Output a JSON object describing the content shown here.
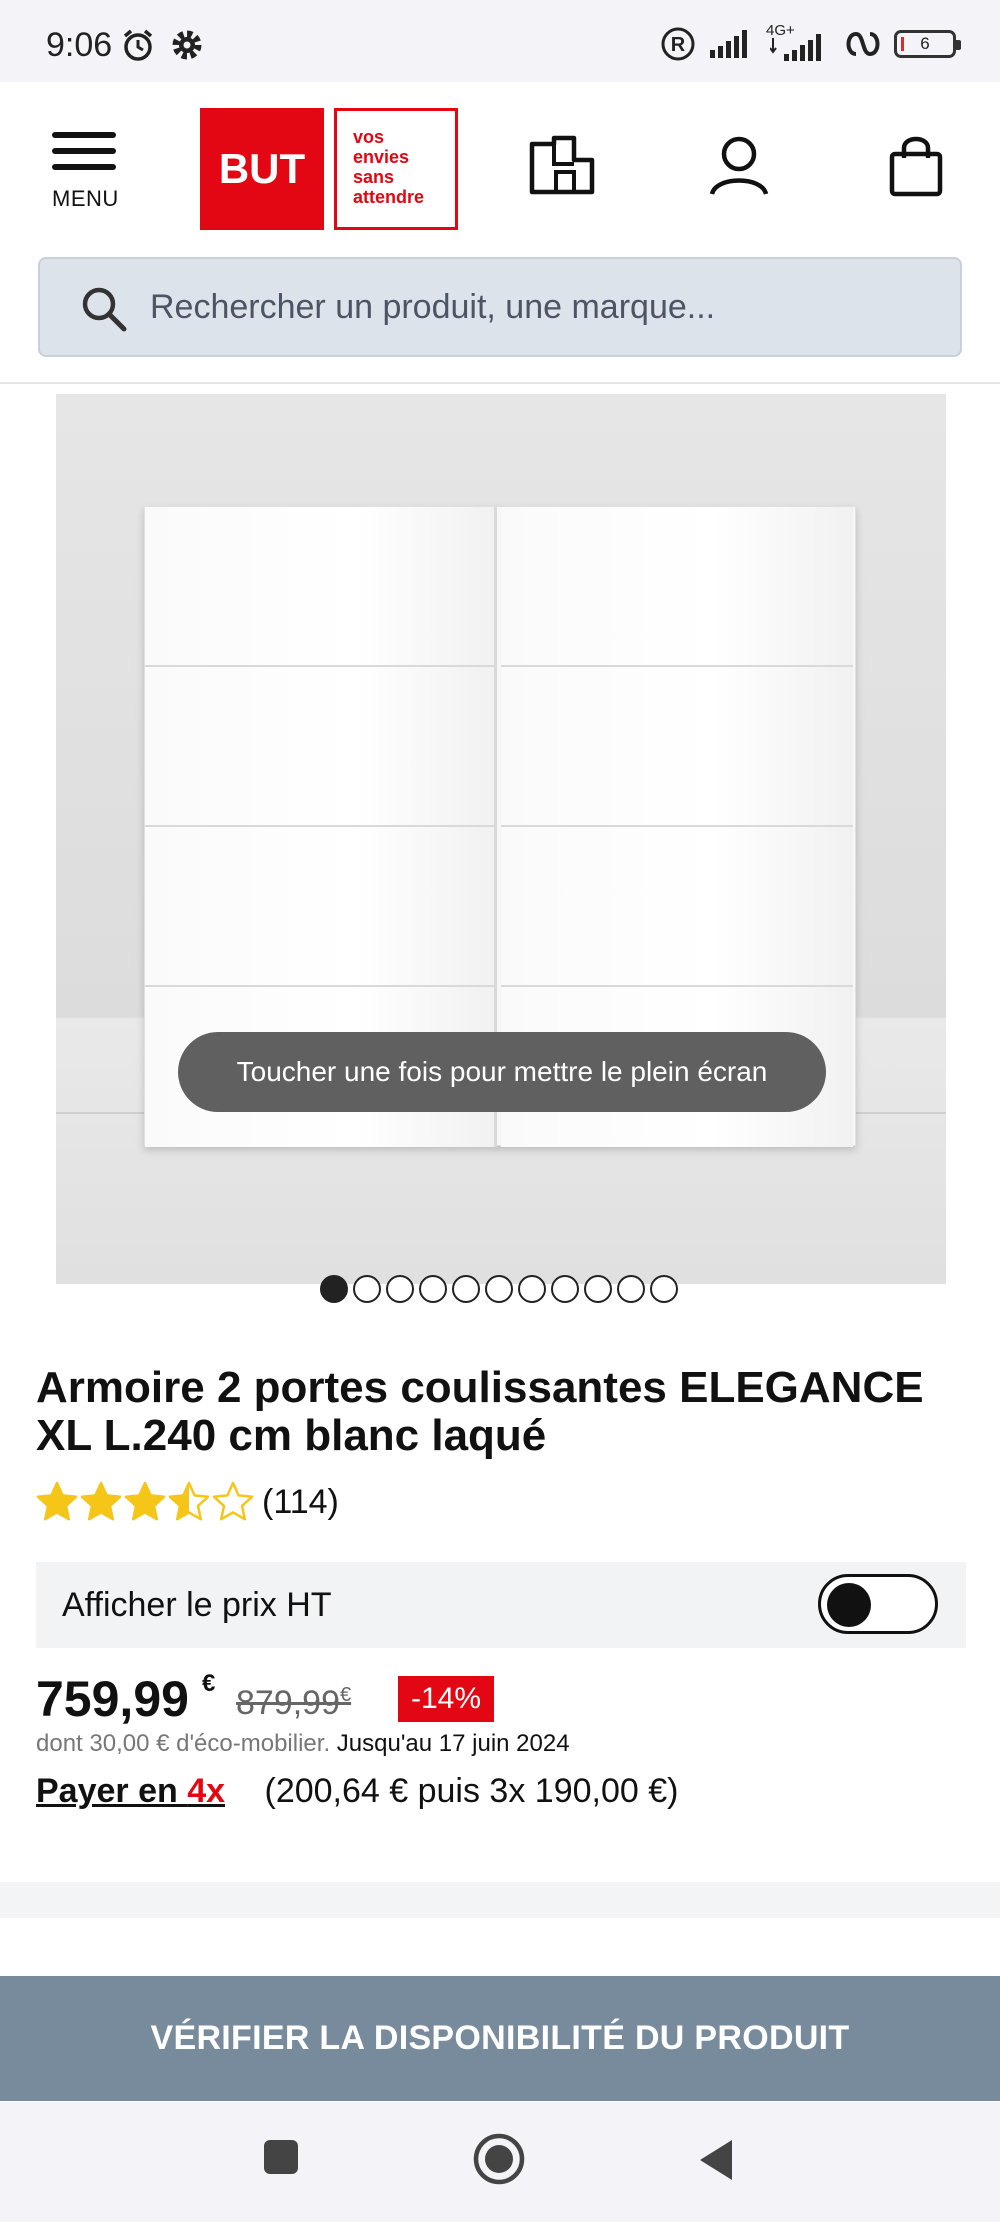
{
  "status_bar": {
    "time": "9:06",
    "network": "4G+",
    "battery": "6"
  },
  "header": {
    "menu_label": "MENU",
    "logo": {
      "brand": "BUT",
      "tagline": [
        "vos",
        "envies",
        "sans",
        "attendre"
      ],
      "color": "#e30613"
    }
  },
  "search": {
    "placeholder": "Rechercher un produit, une marque..."
  },
  "gallery": {
    "toast": "Toucher une fois pour mettre le plein écran",
    "image_count": 11,
    "active_index": 0
  },
  "product": {
    "title": "Armoire 2 portes coulissantes ELEGANCE XL L.240 cm blanc laqué",
    "rating": 3.5,
    "rating_max": 5,
    "review_count": "(114)",
    "ht_label": "Afficher le prix HT",
    "ht_toggle_on": false,
    "price": "759,99",
    "price_currency": "€",
    "old_price": "879,99",
    "old_currency": "€",
    "discount": "-14%",
    "eco_text": "dont 30,00 € d'éco-mobilier.",
    "eco_date": "Jusqu'au 17 juin 2024",
    "pay_prefix": "Payer en ",
    "pay_highlight": "4x",
    "pay_detail": "(200,64 € puis 3x 190,00 €)"
  },
  "cta": {
    "label": "VÉRIFIER LA DISPONIBILITÉ DU PRODUIT",
    "color": "#778b9d"
  },
  "icons": {
    "accent": "#e30613",
    "star_color": "#f5c518"
  }
}
